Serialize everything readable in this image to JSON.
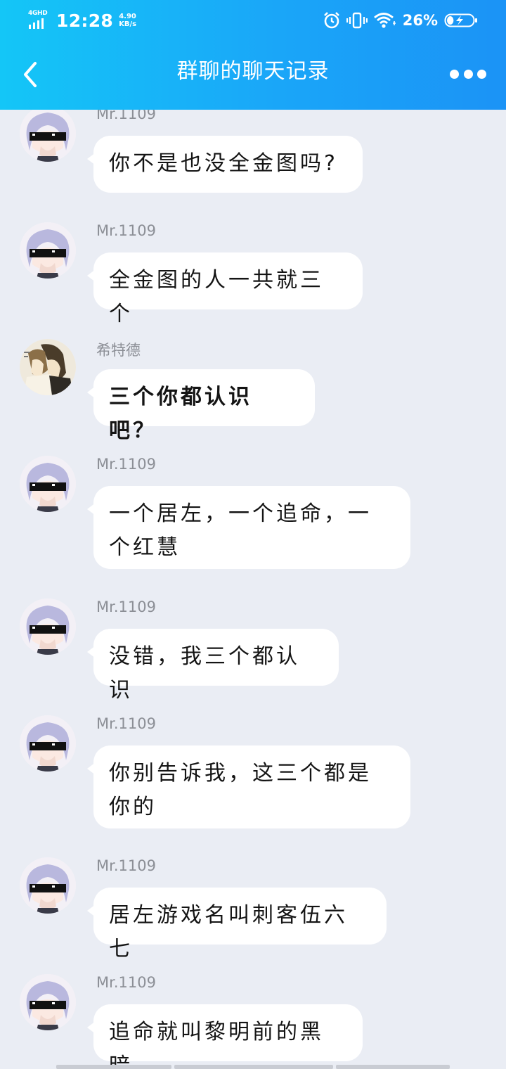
{
  "status_bar": {
    "network": "4GHD",
    "time": "12:28",
    "speed_value": "4.90",
    "speed_unit": "KB/s",
    "battery_percent": "26%",
    "battery_level": 0.26,
    "icons": [
      "alarm-icon",
      "vibrate-icon",
      "wifi-icon",
      "battery-charging-icon"
    ]
  },
  "header": {
    "title": "群聊的聊天记录",
    "back_icon": "chevron-left-icon",
    "more_icon": "more-dots-icon"
  },
  "messages": [
    {
      "sender": "Mr.1109",
      "text": "你不是也没全金图吗?",
      "avatar": "anime-sunglasses"
    },
    {
      "sender": "Mr.1109",
      "text": "全金图的人一共就三个",
      "avatar": "anime-sunglasses"
    },
    {
      "sender": "希特德",
      "text": "三个你都认识吧？",
      "avatar": "manga-couple"
    },
    {
      "sender": "Mr.1109",
      "text": "一个居左，一个追命，一个红慧",
      "avatar": "anime-sunglasses"
    },
    {
      "sender": "Mr.1109",
      "text": "没错，我三个都认识",
      "avatar": "anime-sunglasses"
    },
    {
      "sender": "Mr.1109",
      "text": "你别告诉我，这三个都是你的",
      "avatar": "anime-sunglasses"
    },
    {
      "sender": "Mr.1109",
      "text": "居左游戏名叫刺客伍六七",
      "avatar": "anime-sunglasses"
    },
    {
      "sender": "Mr.1109",
      "text": "追命就叫黎明前的黑暗",
      "avatar": "anime-sunglasses"
    }
  ],
  "colors": {
    "header_start": "#14c6f7",
    "header_end": "#1b93f6",
    "chat_background": "#eaedf4",
    "bubble": "#ffffff",
    "sender_name": "#8c8f96"
  }
}
